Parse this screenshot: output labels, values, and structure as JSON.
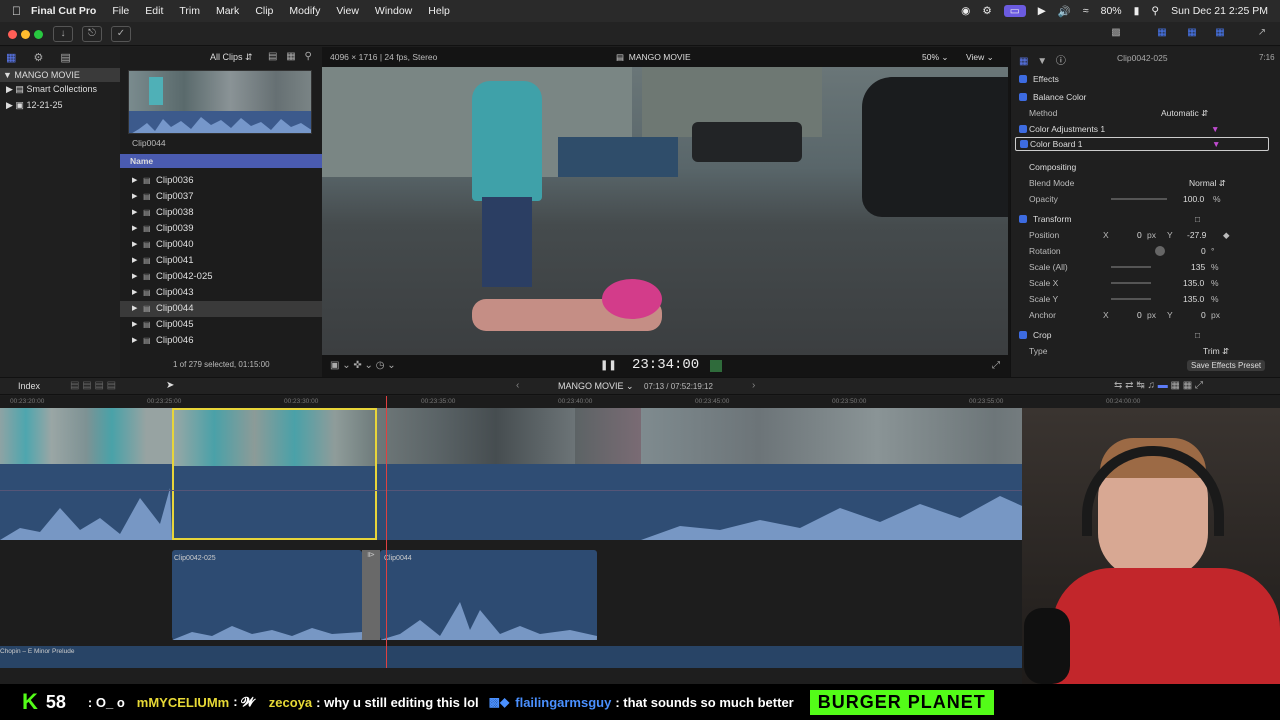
{
  "menubar": {
    "app": "Final Cut Pro",
    "items": [
      "File",
      "Edit",
      "Trim",
      "Mark",
      "Clip",
      "Modify",
      "View",
      "Window",
      "Help"
    ],
    "battery": "80%",
    "datetime": "Sun Dec 21  2:25 PM"
  },
  "library": {
    "items": [
      {
        "label": "MANGO MOVIE"
      },
      {
        "label": "Smart Collections"
      },
      {
        "label": "12-21-25"
      }
    ]
  },
  "browser": {
    "filter": "All Clips",
    "preview_label": "Clip0044",
    "column_header": "Name",
    "clips": [
      "Clip0036",
      "Clip0037",
      "Clip0038",
      "Clip0039",
      "Clip0040",
      "Clip0041",
      "Clip0042-025",
      "Clip0043",
      "Clip0044",
      "Clip0045",
      "Clip0046"
    ],
    "selected": "Clip0044",
    "status": "1 of 279 selected, 01:15:00"
  },
  "viewer": {
    "format": "4096 × 1716 | 24 fps, Stereo",
    "project": "MANGO MOVIE",
    "zoom": "50%",
    "view": "View",
    "timecode": "23:34:00"
  },
  "inspector": {
    "clip_name": "Clip0042-025",
    "duration": "7:16",
    "effects_label": "Effects",
    "balance_color": "Balance Color",
    "method_label": "Method",
    "method_value": "Automatic",
    "color_adj": "Color Adjustments 1",
    "color_board": "Color Board 1",
    "compositing": "Compositing",
    "blend_label": "Blend Mode",
    "blend_value": "Normal",
    "opacity_label": "Opacity",
    "opacity_value": "100.0",
    "opacity_unit": "%",
    "transform": "Transform",
    "position_label": "Position",
    "pos_x_axis": "X",
    "pos_x_value": "0",
    "pos_x_unit": "px",
    "pos_y_axis": "Y",
    "pos_y_value": "-27.9",
    "rotation_label": "Rotation",
    "rotation_value": "0",
    "rotation_unit": "°",
    "scale_all_label": "Scale (All)",
    "scale_all_value": "135",
    "scale_all_unit": "%",
    "scale_x_label": "Scale X",
    "scale_x_value": "135.0",
    "scale_x_unit": "%",
    "scale_y_label": "Scale Y",
    "scale_y_value": "135.0",
    "scale_y_unit": "%",
    "anchor_label": "Anchor",
    "anchor_x_axis": "X",
    "anchor_x_value": "0",
    "anchor_x_unit": "px",
    "anchor_y_axis": "Y",
    "anchor_y_value": "0",
    "anchor_y_unit": "px",
    "crop": "Crop",
    "type_label": "Type",
    "type_value": "Trim",
    "save_preset": "Save Effects Preset"
  },
  "timeline": {
    "index": "Index",
    "project": "MANGO MOVIE",
    "timecodes": "07:13 / 07:52:19:12",
    "ruler": [
      "00:23:20:00",
      "00:23:25:00",
      "00:23:30:00",
      "00:23:35:00",
      "00:23:40:00",
      "00:23:45:00",
      "00:23:50:00",
      "00:23:55:00",
      "00:24:00:00"
    ],
    "clip_a": "Clip0042-025",
    "clip_b": "Clip0044",
    "music": "Chopin – E Minor Prelude"
  },
  "chat": {
    "k_count": "58",
    "msg1": ": O_ o",
    "user2": "mMYCELIUMm",
    "msg2": ": 𝓦",
    "user3": "zecoya",
    "msg3": ": why u still editing this lol",
    "user4": "flailingarmsguy",
    "msg4": ": that sounds so much better",
    "brand": "BURGER PLANET"
  }
}
